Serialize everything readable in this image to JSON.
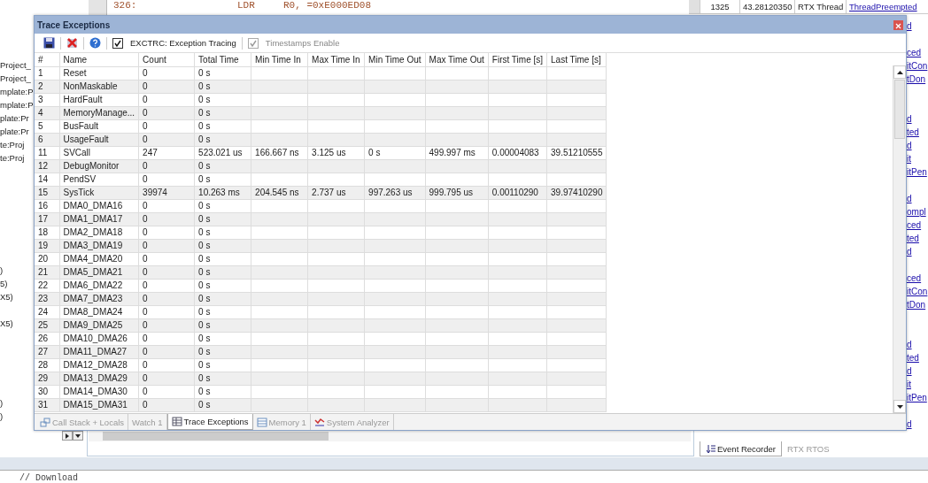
{
  "background": {
    "disassembly": [
      {
        "address": "326:",
        "mnemonic": "LDR",
        "operands": "R0, =0xE000ED08"
      }
    ],
    "project_items": [
      "Project_",
      "Project_",
      "mplate:P",
      "mplate:P",
      "plate:Pr",
      "plate:Pr",
      "te:Proj",
      "te:Proj"
    ],
    "fragment_groups": [
      [
        ")",
        "5)",
        "X5)"
      ],
      [
        "X5)"
      ],
      [
        ")",
        ")"
      ]
    ],
    "event_row": [
      "1325",
      "43.28120350",
      "RTX Thread",
      "ThreadPreempted"
    ],
    "event_link_groups": [
      [
        "d"
      ],
      [
        "ced",
        "itCon",
        "tDon"
      ],
      [
        "d",
        "ted",
        "d",
        "it",
        "itPen"
      ],
      [
        "d",
        "ompl",
        "ced",
        "ted",
        "d"
      ],
      [
        "ced",
        "itCon",
        "tDon"
      ],
      [
        "d",
        "ted",
        "d",
        "it",
        "itPen"
      ],
      [
        "d"
      ]
    ],
    "right_tabs": [
      {
        "label": "Event Recorder",
        "selected": true
      },
      {
        "label": "RTX RTOS",
        "selected": false
      }
    ],
    "editor_line": "// Download"
  },
  "window": {
    "title": "Trace Exceptions",
    "toolbar": {
      "exception_tracing": {
        "label": "EXCTRC: Exception Tracing",
        "checked": true,
        "disabled": false
      },
      "timestamps": {
        "label": "Timestamps Enable",
        "checked": true,
        "disabled": true
      }
    },
    "table": {
      "columns": [
        "#",
        "Name",
        "Count",
        "Total Time",
        "Min Time In",
        "Max Time In",
        "Min Time Out",
        "Max Time Out",
        "First Time [s]",
        "Last Time [s]"
      ],
      "rows": [
        [
          "1",
          "Reset",
          "0",
          "0 s",
          "",
          "",
          "",
          "",
          "",
          ""
        ],
        [
          "2",
          "NonMaskable",
          "0",
          "0 s",
          "",
          "",
          "",
          "",
          "",
          ""
        ],
        [
          "3",
          "HardFault",
          "0",
          "0 s",
          "",
          "",
          "",
          "",
          "",
          ""
        ],
        [
          "4",
          "MemoryManage...",
          "0",
          "0 s",
          "",
          "",
          "",
          "",
          "",
          ""
        ],
        [
          "5",
          "BusFault",
          "0",
          "0 s",
          "",
          "",
          "",
          "",
          "",
          ""
        ],
        [
          "6",
          "UsageFault",
          "0",
          "0 s",
          "",
          "",
          "",
          "",
          "",
          ""
        ],
        [
          "11",
          "SVCall",
          "247",
          "523.021 us",
          "166.667 ns",
          "3.125 us",
          "0 s",
          "499.997 ms",
          "0.00004083",
          "39.51210555"
        ],
        [
          "12",
          "DebugMonitor",
          "0",
          "0 s",
          "",
          "",
          "",
          "",
          "",
          ""
        ],
        [
          "14",
          "PendSV",
          "0",
          "0 s",
          "",
          "",
          "",
          "",
          "",
          ""
        ],
        [
          "15",
          "SysTick",
          "39974",
          "10.263 ms",
          "204.545 ns",
          "2.737 us",
          "997.263 us",
          "999.795 us",
          "0.00110290",
          "39.97410290"
        ],
        [
          "16",
          "DMA0_DMA16",
          "0",
          "0 s",
          "",
          "",
          "",
          "",
          "",
          ""
        ],
        [
          "17",
          "DMA1_DMA17",
          "0",
          "0 s",
          "",
          "",
          "",
          "",
          "",
          ""
        ],
        [
          "18",
          "DMA2_DMA18",
          "0",
          "0 s",
          "",
          "",
          "",
          "",
          "",
          ""
        ],
        [
          "19",
          "DMA3_DMA19",
          "0",
          "0 s",
          "",
          "",
          "",
          "",
          "",
          ""
        ],
        [
          "20",
          "DMA4_DMA20",
          "0",
          "0 s",
          "",
          "",
          "",
          "",
          "",
          ""
        ],
        [
          "21",
          "DMA5_DMA21",
          "0",
          "0 s",
          "",
          "",
          "",
          "",
          "",
          ""
        ],
        [
          "22",
          "DMA6_DMA22",
          "0",
          "0 s",
          "",
          "",
          "",
          "",
          "",
          ""
        ],
        [
          "23",
          "DMA7_DMA23",
          "0",
          "0 s",
          "",
          "",
          "",
          "",
          "",
          ""
        ],
        [
          "24",
          "DMA8_DMA24",
          "0",
          "0 s",
          "",
          "",
          "",
          "",
          "",
          ""
        ],
        [
          "25",
          "DMA9_DMA25",
          "0",
          "0 s",
          "",
          "",
          "",
          "",
          "",
          ""
        ],
        [
          "26",
          "DMA10_DMA26",
          "0",
          "0 s",
          "",
          "",
          "",
          "",
          "",
          ""
        ],
        [
          "27",
          "DMA11_DMA27",
          "0",
          "0 s",
          "",
          "",
          "",
          "",
          "",
          ""
        ],
        [
          "28",
          "DMA12_DMA28",
          "0",
          "0 s",
          "",
          "",
          "",
          "",
          "",
          ""
        ],
        [
          "29",
          "DMA13_DMA29",
          "0",
          "0 s",
          "",
          "",
          "",
          "",
          "",
          ""
        ],
        [
          "30",
          "DMA14_DMA30",
          "0",
          "0 s",
          "",
          "",
          "",
          "",
          "",
          ""
        ],
        [
          "31",
          "DMA15_DMA31",
          "0",
          "0 s",
          "",
          "",
          "",
          "",
          "",
          ""
        ]
      ]
    },
    "tabs": [
      {
        "label": "Call Stack + Locals",
        "selected": false,
        "kind": "stack"
      },
      {
        "label": "Watch 1",
        "selected": false,
        "kind": "none"
      },
      {
        "label": "Trace Exceptions",
        "selected": true,
        "kind": "trace"
      },
      {
        "label": "Memory 1",
        "selected": false,
        "kind": "memory"
      },
      {
        "label": "System Analyzer",
        "selected": false,
        "kind": "analyzer"
      }
    ]
  }
}
